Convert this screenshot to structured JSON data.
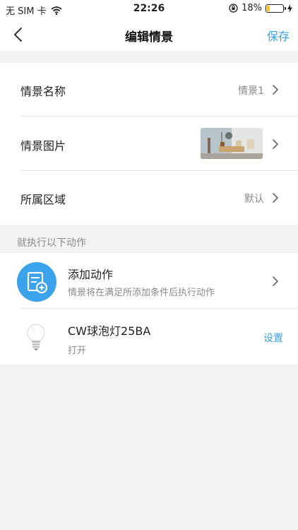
{
  "status_bar": {
    "carrier": "无 SIM 卡",
    "time": "22:26",
    "battery": "18%",
    "battery_level": 0.18
  },
  "nav": {
    "title": "编辑情景",
    "save_label": "保存"
  },
  "settings": {
    "name_label": "情景名称",
    "name_value": "情景1",
    "image_label": "情景图片",
    "area_label": "所属区域",
    "area_value": "默认"
  },
  "actions": {
    "header": "就执行以下动作",
    "add_title": "添加动作",
    "add_subtitle": "情景将在满足所添加条件后执行动作",
    "device_name": "CW球泡灯25BA",
    "device_state": "打开",
    "device_setting": "设置"
  },
  "colors": {
    "accent": "#3aa0e6",
    "icon_blue": "#3ba2ec",
    "battery_fill": "#f5c518"
  }
}
